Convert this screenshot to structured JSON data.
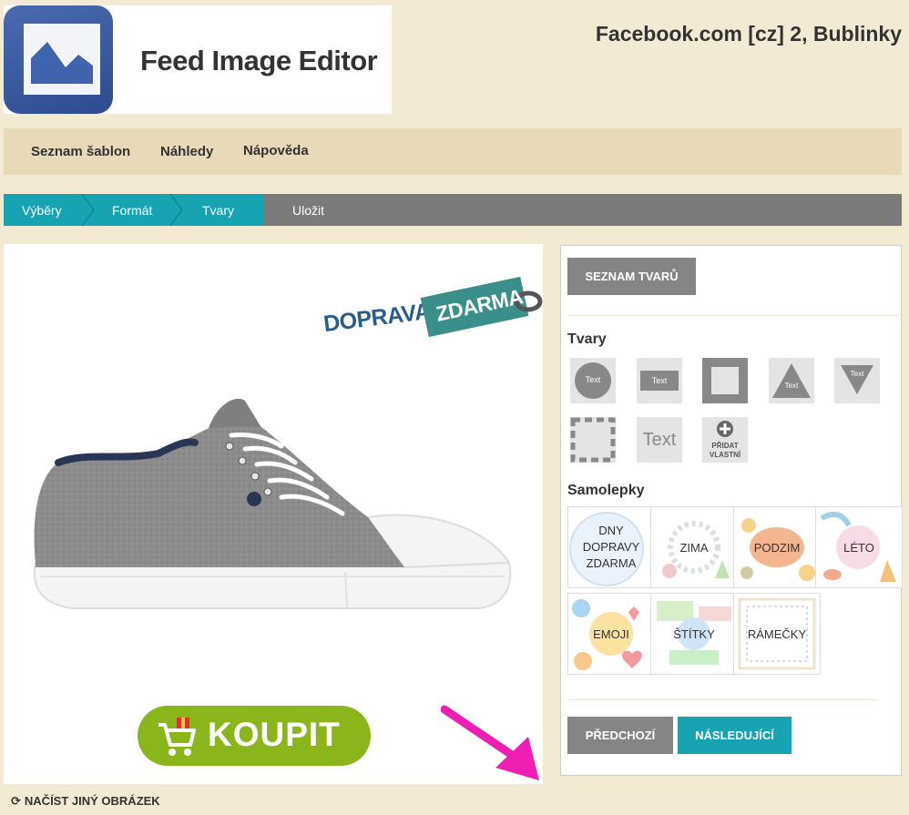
{
  "header": {
    "app_title": "Feed Image Editor",
    "account_title": "Facebook.com [cz] 2, Bublinky"
  },
  "nav": {
    "items": [
      "Seznam šablon",
      "Náhledy",
      "Nápověda"
    ]
  },
  "steps": {
    "items": [
      "Výběry",
      "Formát",
      "Tvary",
      "Uložit"
    ],
    "active_count": 3,
    "active_color": "#17a3b2",
    "inactive_color": "#7b7b7b"
  },
  "preview": {
    "badge_text_1": "DOPRAVA",
    "badge_text_2": "ZDARMA",
    "buy_label": "KOUPIT",
    "reload_label": "NAČÍST JINÝ OBRÁZEK"
  },
  "side": {
    "shape_list_button": "SEZNAM TVARŮ",
    "shapes_title": "Tvary",
    "shape_tile_texts": [
      "Text",
      "Text",
      "Text",
      "Text",
      "Text"
    ],
    "add_custom_line1": "PŘIDAT",
    "add_custom_line2": "VLASTNÍ",
    "stickers_title": "Samolepky",
    "stickers": [
      "DNY DOPRAVY ZDARMA",
      "ZIMA",
      "PODZIM",
      "LÉTO",
      "EMOJI",
      "ŠTÍTKY",
      "RÁMEČKY"
    ],
    "prev_button": "PŘEDCHOZÍ",
    "next_button": "NÁSLEDUJÍCÍ"
  },
  "colors": {
    "background": "#f3ead4",
    "accent_teal": "#17a3b2",
    "buy_green": "#8ab61c",
    "arrow_magenta": "#f01fb4"
  }
}
